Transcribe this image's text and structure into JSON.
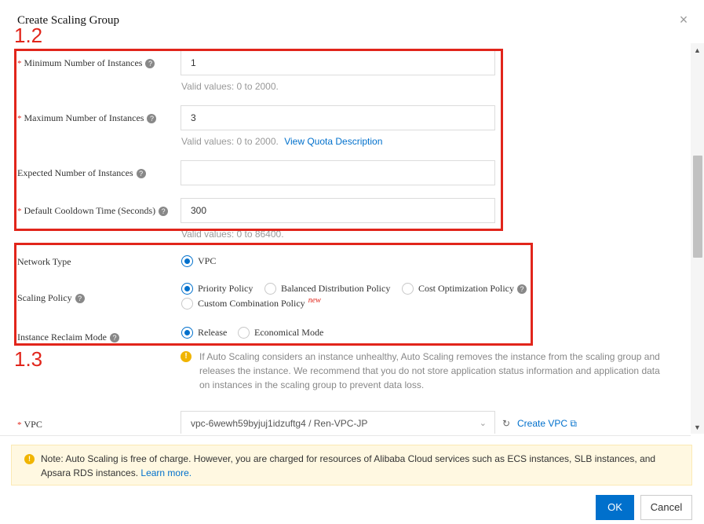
{
  "dialog": {
    "title": "Create Scaling Group",
    "close_glyph": "×"
  },
  "annotations": {
    "step_12": "1.2",
    "step_13": "1.3",
    "color": "#e1251b"
  },
  "fields": {
    "min_instances": {
      "label": "Minimum Number of Instances",
      "value": "1",
      "hint": "Valid values: 0 to 2000."
    },
    "max_instances": {
      "label": "Maximum Number of Instances",
      "value": "3",
      "hint": "Valid values: 0 to 2000.",
      "hint_link": "View Quota Description"
    },
    "expected_instances": {
      "label": "Expected Number of Instances",
      "value": ""
    },
    "cooldown": {
      "label": "Default Cooldown Time (Seconds)",
      "value": "300",
      "hint": "Valid values: 0 to 86400."
    }
  },
  "network_type": {
    "label": "Network Type",
    "options": [
      "VPC"
    ],
    "selected": "VPC"
  },
  "scaling_policy": {
    "label": "Scaling Policy",
    "options": [
      "Priority Policy",
      "Balanced Distribution Policy",
      "Cost Optimization Policy",
      "Custom Combination Policy"
    ],
    "new_badge": "new",
    "selected": "Priority Policy"
  },
  "reclaim_mode": {
    "label": "Instance Reclaim Mode",
    "options": [
      "Release",
      "Economical Mode"
    ],
    "selected": "Release",
    "warning": "If Auto Scaling considers an instance unhealthy, Auto Scaling removes the instance from the scaling group and releases the instance. We recommend that you do not store application status information and application data on instances in the scaling group to prevent data loss."
  },
  "vpc": {
    "label": "VPC",
    "value": "vpc-6wewh59byjuj1idzuftg4 / Ren-VPC-JP",
    "create_link": "Create VPC"
  },
  "notice": {
    "text": "Note: Auto Scaling is free of charge. However, you are charged for resources of Alibaba Cloud services such as ECS instances, SLB instances, and Apsara RDS instances.",
    "link": "Learn more."
  },
  "footer": {
    "ok_label": "OK",
    "cancel_label": "Cancel"
  },
  "colors": {
    "primary": "#0070cc",
    "required": "#e1251b",
    "warning": "#f0b400"
  }
}
